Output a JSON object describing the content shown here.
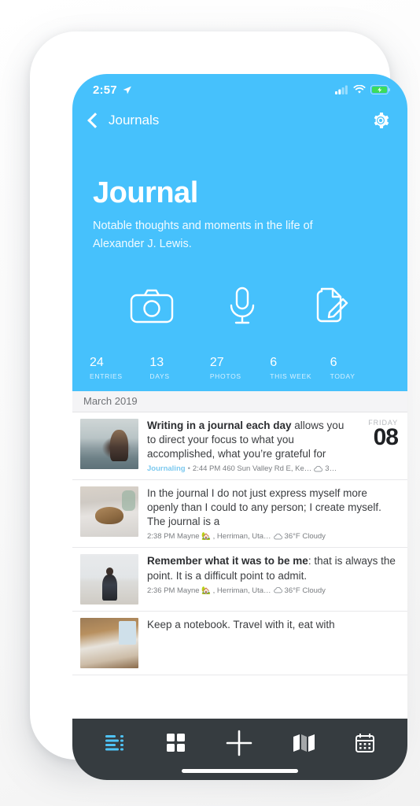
{
  "status_bar": {
    "time": "2:57",
    "location_icon": "location-arrow-icon",
    "signal_icon": "cellular-signal-icon",
    "wifi_icon": "wifi-icon",
    "battery_icon": "battery-charging-icon"
  },
  "nav": {
    "back_label": "Journals",
    "back_icon": "chevron-left-icon",
    "settings_icon": "gear-icon"
  },
  "hero": {
    "title": "Journal",
    "subtitle": "Notable thoughts and moments in the life of Alexander J. Lewis.",
    "background_color": "#46C1FC",
    "actions": [
      {
        "name": "camera-icon",
        "label": "Camera"
      },
      {
        "name": "microphone-icon",
        "label": "Audio"
      },
      {
        "name": "compose-note-icon",
        "label": "Write"
      }
    ],
    "stats": [
      {
        "value": "24",
        "label": "ENTRIES"
      },
      {
        "value": "13",
        "label": "DAYS"
      },
      {
        "value": "27",
        "label": "PHOTOS"
      },
      {
        "value": "6",
        "label": "THIS WEEK"
      },
      {
        "value": "6",
        "label": "TODAY"
      }
    ]
  },
  "list": {
    "section_header": "March 2019",
    "entries": [
      {
        "lead": "Writing in a journal each day",
        "rest": " allows you to direct your focus to what you accomplished, what you’re grateful for",
        "tag": "Journaling",
        "separator": "•",
        "meta": "2:44 PM 460 Sun Valley Rd E, Ke…",
        "weather_icon": "cloud-icon",
        "weather": "3…",
        "date_dow": "FRIDAY",
        "date_num": "08",
        "thumb": "woman-sitting-by-water"
      },
      {
        "lead": "",
        "rest": "In the journal I do not just express myself more openly than I could to any person; I create myself. The journal is a",
        "tag": "",
        "separator": "",
        "meta": "2:38 PM Mayne 🏡 , Herriman, Uta…",
        "weather_icon": "cloud-icon",
        "weather": "36°F Cloudy",
        "date_dow": "",
        "date_num": "",
        "thumb": "dog-sleeping-on-bed"
      },
      {
        "lead": "Remember what it was to be me",
        "rest": ": that is always the point. It is a difficult point to admit.",
        "tag": "",
        "separator": "",
        "meta": "2:36 PM Mayne 🏡 , Herriman, Uta…",
        "weather_icon": "cloud-icon",
        "weather": "36°F Cloudy",
        "date_dow": "",
        "date_num": "",
        "thumb": "person-walking-in-snow"
      },
      {
        "lead": "",
        "rest": "Keep a notebook. Travel with it, eat with",
        "tag": "",
        "separator": "",
        "meta": "",
        "weather_icon": "",
        "weather": "",
        "date_dow": "",
        "date_num": "",
        "thumb": "desk-with-window"
      }
    ]
  },
  "tabbar": {
    "background_color": "#363C40",
    "active_color": "#4FC3F7",
    "items": [
      {
        "name": "list-view-tab",
        "icon": "list-icon",
        "active": true
      },
      {
        "name": "grid-view-tab",
        "icon": "grid-icon",
        "active": false
      },
      {
        "name": "add-entry-tab",
        "icon": "plus-icon",
        "active": false
      },
      {
        "name": "map-view-tab",
        "icon": "map-icon",
        "active": false
      },
      {
        "name": "calendar-view-tab",
        "icon": "calendar-icon",
        "active": false
      }
    ]
  }
}
